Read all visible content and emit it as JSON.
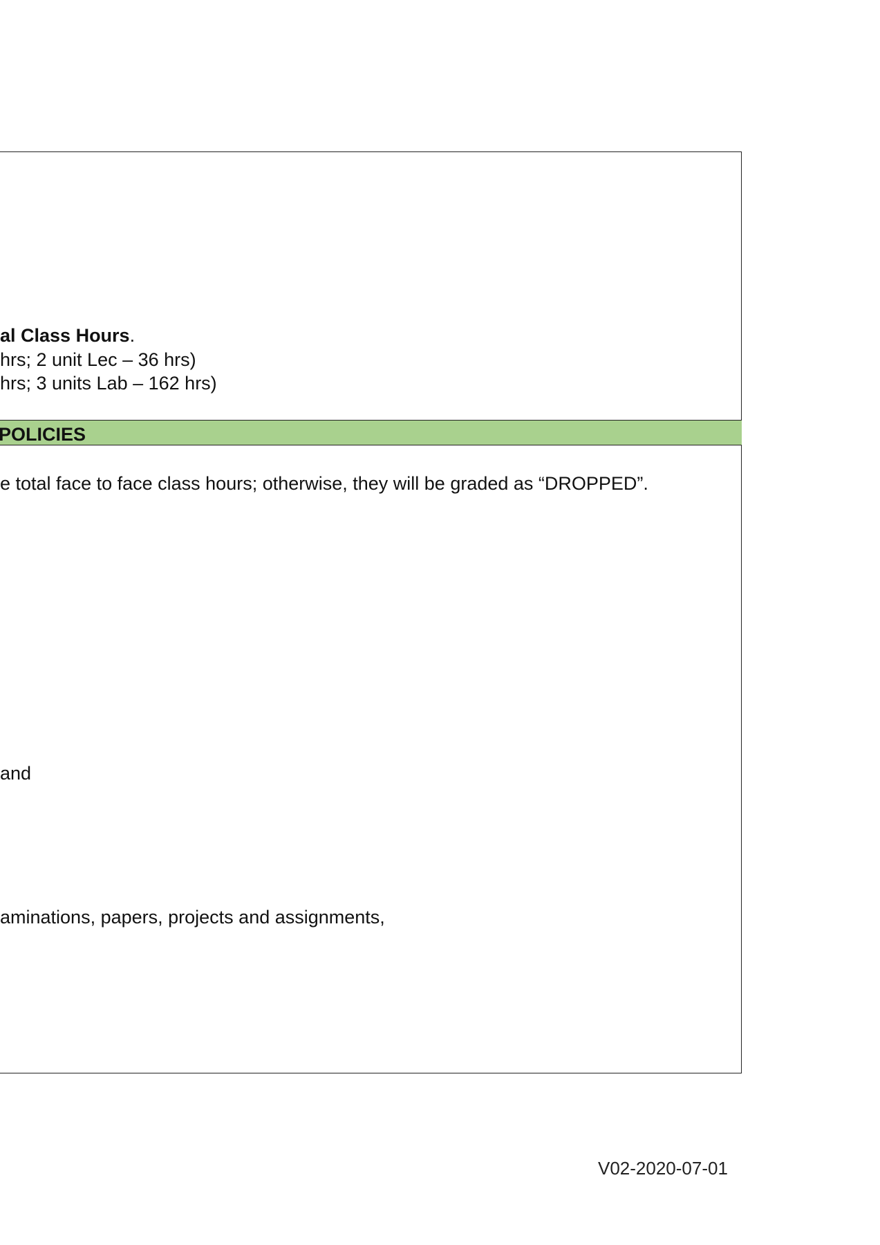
{
  "upper_box": {
    "line1_bold": "al Class Hours",
    "line1_tail": ".",
    "line2": " hrs; 2 unit Lec – 36 hrs)",
    "line3": "hrs; 3 units Lab – 162 hrs)"
  },
  "policies": {
    "header": "POLICIES",
    "line_attendance": "e total face to face class hours; otherwise, they will be graded as “DROPPED”.",
    "line_and": "and",
    "line_examinations": "aminations, papers, projects and assignments,"
  },
  "footer": {
    "version": "V02-2020-07-01"
  }
}
